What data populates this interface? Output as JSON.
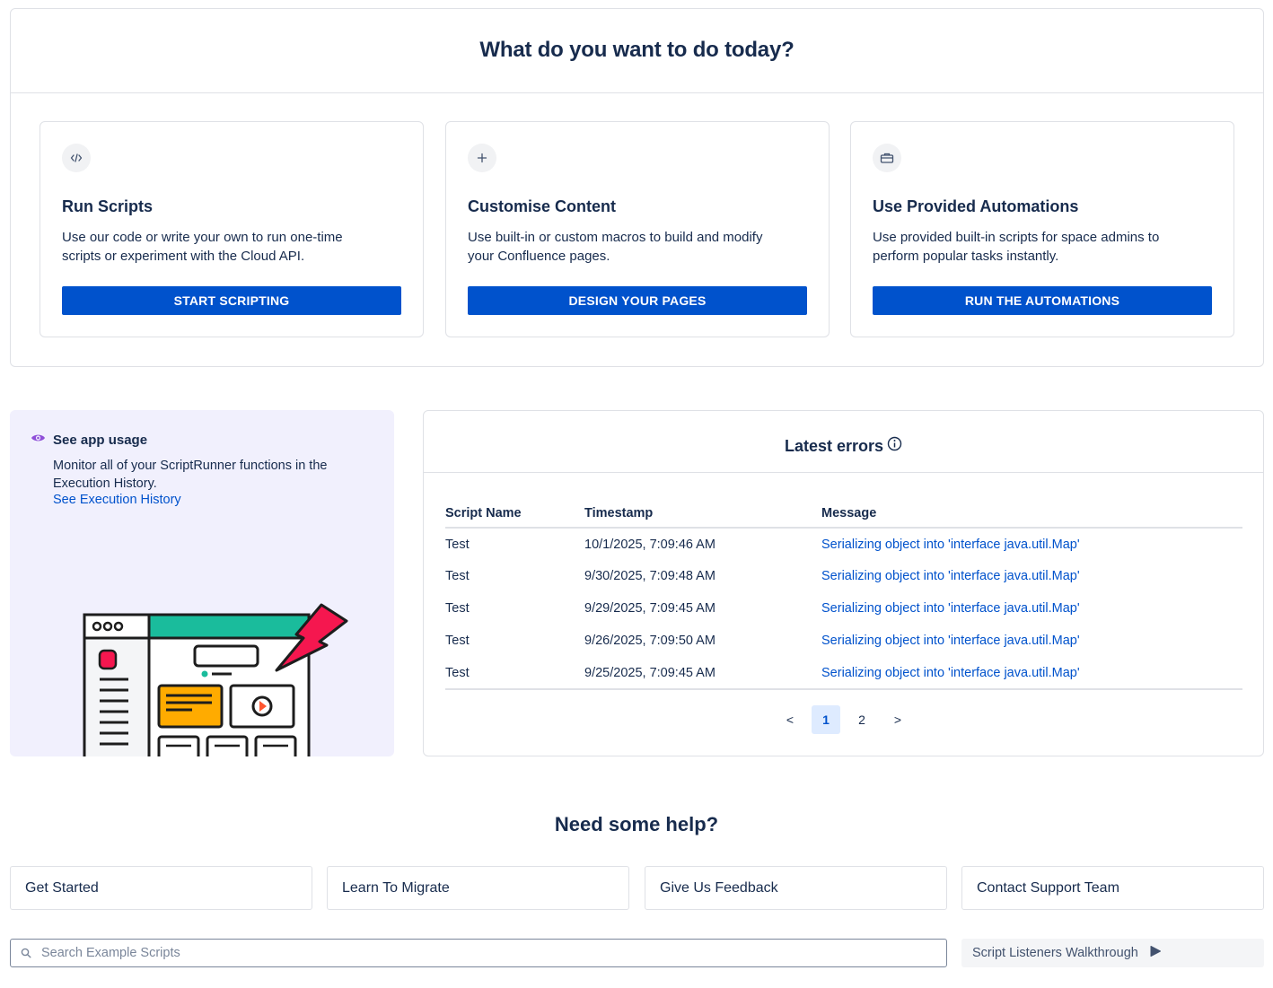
{
  "header": {
    "title": "What do you want to do today?"
  },
  "cards": [
    {
      "icon": "code-icon",
      "title": "Run Scripts",
      "description": "Use our code or write your own to run one-time scripts or experiment with the Cloud API.",
      "button": "START SCRIPTING"
    },
    {
      "icon": "plus-icon",
      "title": "Customise Content",
      "description": "Use built-in or custom macros to build and modify your Confluence pages.",
      "button": "DESIGN YOUR PAGES"
    },
    {
      "icon": "briefcase-icon",
      "title": "Use Provided Automations",
      "description": "Use provided built-in scripts for space admins to perform popular tasks instantly.",
      "button": "RUN THE AUTOMATIONS"
    }
  ],
  "usage": {
    "title": "See app usage",
    "description": "Monitor all of your ScriptRunner functions in the Execution History.",
    "link": "See Execution History"
  },
  "errors": {
    "title": "Latest errors",
    "columns": [
      "Script Name",
      "Timestamp",
      "Message"
    ],
    "rows": [
      {
        "name": "Test",
        "timestamp": "10/1/2025, 7:09:46 AM",
        "message": "Serializing object into 'interface java.util.Map'"
      },
      {
        "name": "Test",
        "timestamp": "9/30/2025, 7:09:48 AM",
        "message": "Serializing object into 'interface java.util.Map'"
      },
      {
        "name": "Test",
        "timestamp": "9/29/2025, 7:09:45 AM",
        "message": "Serializing object into 'interface java.util.Map'"
      },
      {
        "name": "Test",
        "timestamp": "9/26/2025, 7:09:50 AM",
        "message": "Serializing object into 'interface java.util.Map'"
      },
      {
        "name": "Test",
        "timestamp": "9/25/2025, 7:09:45 AM",
        "message": "Serializing object into 'interface java.util.Map'"
      }
    ],
    "pagination": {
      "prev": "<",
      "pages": [
        "1",
        "2"
      ],
      "current": "1",
      "next": ">"
    }
  },
  "help": {
    "title": "Need some help?",
    "buttons": [
      "Get Started",
      "Learn To Migrate",
      "Give Us Feedback",
      "Contact Support Team"
    ]
  },
  "search": {
    "placeholder": "Search Example Scripts",
    "value": ""
  },
  "walkthrough": {
    "label": "Script Listeners Walkthrough"
  },
  "colors": {
    "primary": "#0052cc",
    "text": "#172b4d",
    "usage_bg": "#f1f0fd",
    "link": "#0052cc",
    "active_page_bg": "#deebff"
  }
}
